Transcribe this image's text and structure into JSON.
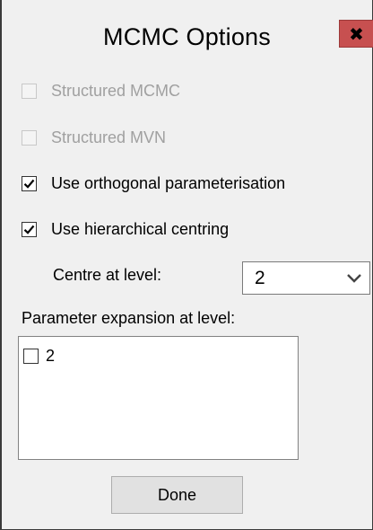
{
  "window": {
    "title": "MCMC Options",
    "close_glyph": "✖",
    "close_color": "#c75050"
  },
  "options": [
    {
      "label": "Structured MCMC",
      "checked": false,
      "enabled": false
    },
    {
      "label": "Structured MVN",
      "checked": false,
      "enabled": false
    },
    {
      "label": "Use orthogonal parameterisation",
      "checked": true,
      "enabled": true
    },
    {
      "label": "Use hierarchical centring",
      "checked": true,
      "enabled": true
    }
  ],
  "centre": {
    "label": "Centre at level:",
    "selected": "2"
  },
  "expansion": {
    "label": "Parameter expansion at level:",
    "items": [
      {
        "label": "2",
        "checked": false
      }
    ]
  },
  "done_label": "Done"
}
